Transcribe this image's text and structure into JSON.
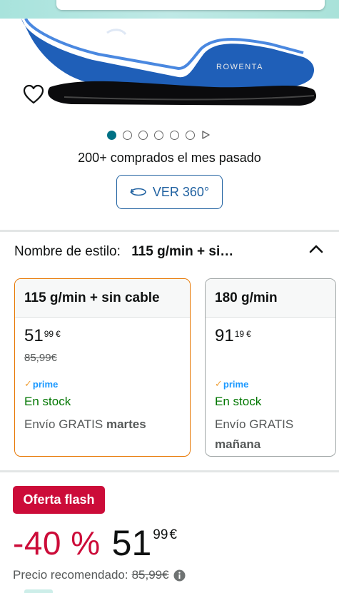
{
  "product": {
    "brand_on_image": "Rowenta",
    "bought_text": "200+ comprados el mes pasado",
    "view_360_label": "VER 360°"
  },
  "gallery": {
    "dot_count": 6,
    "active_index": 0
  },
  "style": {
    "label": "Nombre de estilo:",
    "value": "115 g/min + si…"
  },
  "options": [
    {
      "name": "115 g/min + sin cable",
      "price_whole": "51",
      "price_fraction": "99",
      "currency": "€",
      "old_price": "85,99€",
      "prime_label": "prime",
      "stock": "En stock",
      "shipping_prefix": "Envío GRATIS",
      "shipping_day": "martes",
      "selected": true
    },
    {
      "name": "180 g/min",
      "price_whole": "91",
      "price_fraction": "19",
      "currency": "€",
      "prime_label": "prime",
      "stock": "En stock",
      "shipping_prefix": "Envío GRATIS",
      "shipping_day": "mañana",
      "selected": false
    }
  ],
  "deal": {
    "badge": "Oferta flash",
    "discount": "-40 %",
    "price_whole": "51",
    "price_fraction": "99",
    "currency": "€",
    "rrp_label": "Precio recomendado:",
    "rrp_value": "85,99€"
  },
  "colors": {
    "accent_teal": "#007185",
    "link_blue": "#2162a1",
    "deal_red": "#cc0c39",
    "stock_green": "#007600",
    "selected_border": "#e77600",
    "prime_blue": "#1a98ff"
  }
}
